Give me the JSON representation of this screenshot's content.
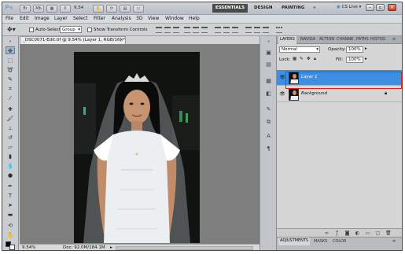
{
  "app": {
    "logo": "Ps",
    "zoom_value": "9.54",
    "workspaces": [
      "ESSENTIALS",
      "DESIGN",
      "PAINTING"
    ],
    "cs_live": "CS Live",
    "window_controls": [
      "minimize",
      "restore",
      "close"
    ]
  },
  "menu": [
    "File",
    "Edit",
    "Image",
    "Layer",
    "Select",
    "Filter",
    "Analysis",
    "3D",
    "View",
    "Window",
    "Help"
  ],
  "options": {
    "auto_select_label": "Auto-Select:",
    "auto_select_value": "Group",
    "transform_label": "Show Transform Controls"
  },
  "document": {
    "tab_title": "_DSC0071-Edit.tif @ 9.54% (Layer 1, RGB/16) *",
    "status_zoom": "9.54%",
    "status_doc": "Doc: 92.0M/184.1M"
  },
  "panel": {
    "tabs": [
      "LAYERS",
      "NAVIGA",
      "ACTION",
      "CHANNE",
      "PATHS",
      "HISTOG"
    ],
    "blend_mode": "Normal",
    "opacity_label": "Opacity:",
    "opacity_value": "100%",
    "lock_label": "Lock:",
    "fill_label": "Fill:",
    "fill_value": "100%",
    "layers": [
      {
        "name": "Layer 1",
        "selected": true
      },
      {
        "name": "Background",
        "selected": false
      }
    ],
    "bottom_tabs": [
      "ADJUSTMENTS",
      "MASKS",
      "COLOR"
    ]
  },
  "colors": {
    "selected_layer": "#3c8fe3",
    "highlight_box": "#e02020"
  }
}
